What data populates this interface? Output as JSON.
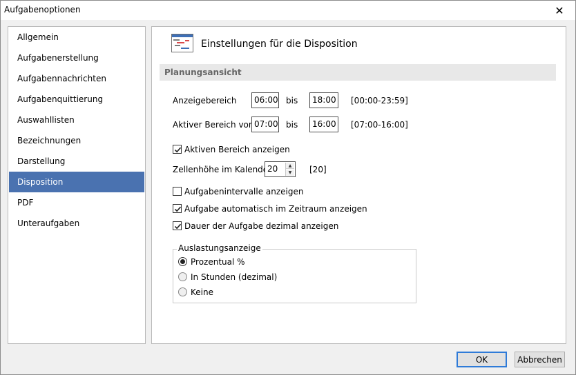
{
  "window": {
    "title": "Aufgabenoptionen",
    "close_glyph": "✕"
  },
  "nav": {
    "items": [
      {
        "label": "Allgemein"
      },
      {
        "label": "Aufgabenerstellung"
      },
      {
        "label": "Aufgabennachrichten"
      },
      {
        "label": "Aufgabenquittierung"
      },
      {
        "label": "Auswahllisten"
      },
      {
        "label": "Bezeichnungen"
      },
      {
        "label": "Darstellung"
      },
      {
        "label": "Disposition"
      },
      {
        "label": "PDF"
      },
      {
        "label": "Unteraufgaben"
      }
    ],
    "selected_index": 7,
    "selected_color": "#4a72b0"
  },
  "panel": {
    "header_icon": "gantt-chart-icon",
    "title": "Einstellungen für die Disposition",
    "section": "Planungsansicht",
    "anzeigebereich": {
      "label": "Anzeigebereich",
      "from": "06:00",
      "bis": "bis",
      "to": "18:00",
      "hint": "[00:00-23:59]"
    },
    "aktiver_bereich": {
      "label": "Aktiver Bereich von",
      "from": "07:00",
      "bis": "bis",
      "to": "16:00",
      "hint": "[07:00-16:00]"
    },
    "show_active": {
      "label": "Aktiven Bereich anzeigen",
      "checked": true
    },
    "zellenhoehe": {
      "label": "Zellenhöhe im Kalender",
      "value": "20",
      "hint": "[20]"
    },
    "checks": [
      {
        "label": "Aufgabenintervalle anzeigen",
        "checked": false
      },
      {
        "label": "Aufgabe automatisch im Zeitraum anzeigen",
        "checked": true
      },
      {
        "label": "Dauer der Aufgabe dezimal anzeigen",
        "checked": true
      }
    ],
    "auslastung": {
      "title": "Auslastungsanzeige",
      "options": [
        {
          "label": "Prozentual %",
          "selected": true
        },
        {
          "label": "In Stunden (dezimal)",
          "selected": false
        },
        {
          "label": "Keine",
          "selected": false
        }
      ]
    }
  },
  "buttons": {
    "ok": "OK",
    "cancel": "Abbrechen"
  }
}
